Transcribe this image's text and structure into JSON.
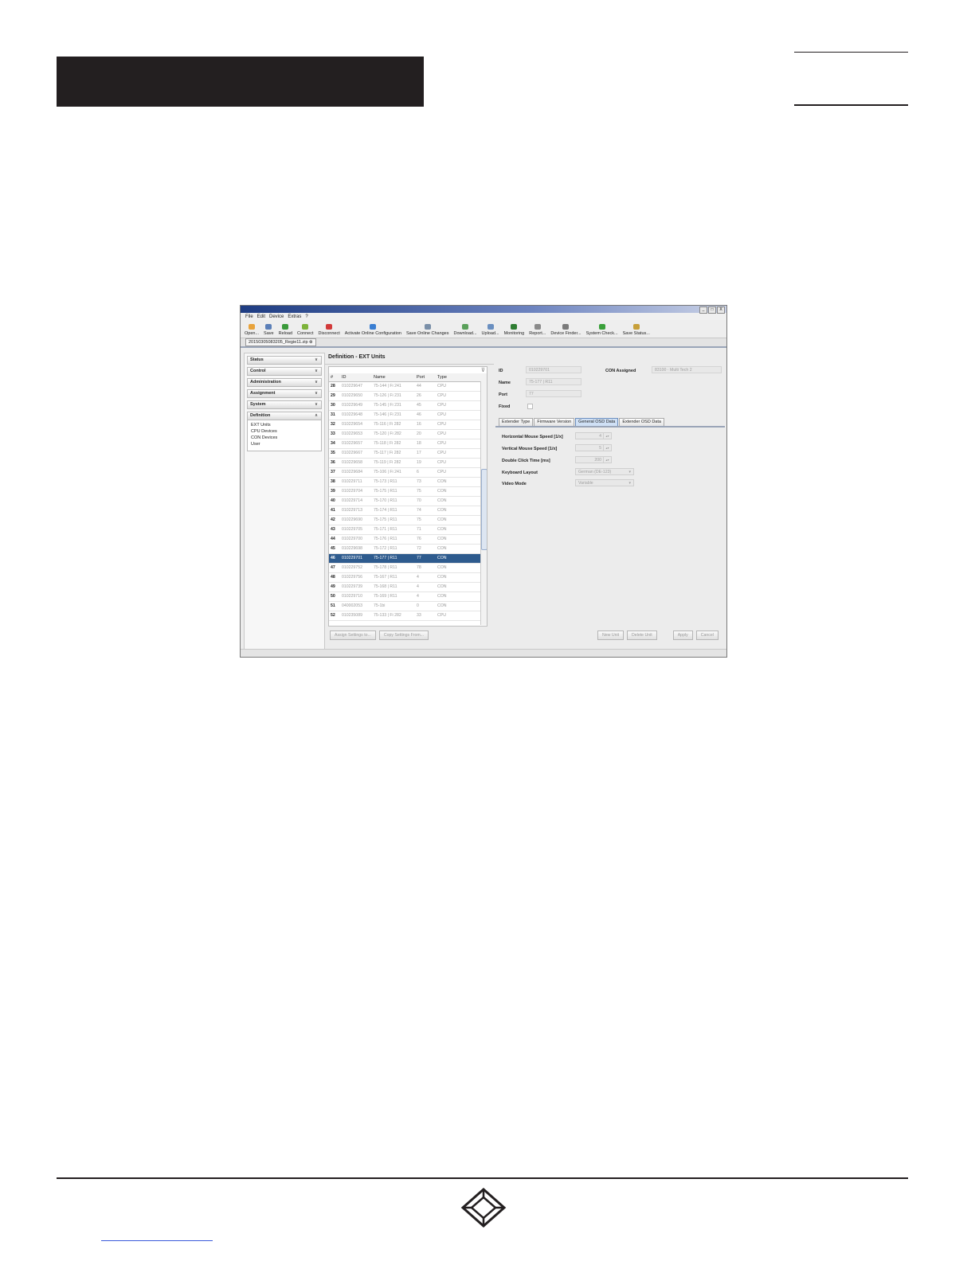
{
  "app": {
    "menu": [
      "File",
      "Edit",
      "Device",
      "Extras",
      "?"
    ],
    "window_controls": [
      "_",
      "□",
      "X"
    ],
    "toolbar": [
      {
        "label": "Open...",
        "icon": "folder-icon",
        "color": "#e8a33c"
      },
      {
        "label": "Save",
        "icon": "disk-icon",
        "color": "#5b7fb8"
      },
      {
        "label": "Reload",
        "icon": "reload-icon",
        "color": "#3a9a3a"
      },
      {
        "label": "Connect",
        "icon": "plug-connect-icon",
        "color": "#7db33a"
      },
      {
        "label": "Disconnect",
        "icon": "plug-disconnect-icon",
        "color": "#d23a3a"
      },
      {
        "label": "Activate Online Configuration",
        "icon": "globe-icon",
        "color": "#3a7ed2"
      },
      {
        "label": "Save Online Changes",
        "icon": "save-online-icon",
        "color": "#7a8fa8"
      },
      {
        "label": "Download...",
        "icon": "download-icon",
        "color": "#5aa05a"
      },
      {
        "label": "Upload...",
        "icon": "upload-icon",
        "color": "#6a8fc0"
      },
      {
        "label": "Monitoring",
        "icon": "monitor-icon",
        "color": "#2e7d32"
      },
      {
        "label": "Report...",
        "icon": "report-icon",
        "color": "#8a8a8a"
      },
      {
        "label": "Device Finder...",
        "icon": "device-finder-icon",
        "color": "#7a7a7a"
      },
      {
        "label": "System Check...",
        "icon": "check-icon",
        "color": "#3aa03a"
      },
      {
        "label": "Save Status...",
        "icon": "save-status-icon",
        "color": "#c8a03a"
      }
    ],
    "doc_tab": "20150305083205_Regie11.zip"
  },
  "sidebar": {
    "sections": [
      {
        "label": "Status",
        "chevron": "∨"
      },
      {
        "label": "Control",
        "chevron": "∨"
      },
      {
        "label": "Administration",
        "chevron": "∨"
      },
      {
        "label": "Assignment",
        "chevron": "∨"
      },
      {
        "label": "System",
        "chevron": "∨"
      },
      {
        "label": "Definition",
        "chevron": "∧"
      }
    ],
    "definition_items": [
      "EXT Units",
      "CPU Devices",
      "CON Devices",
      "User"
    ]
  },
  "main": {
    "title": "Definition - EXT Units",
    "columns": [
      "#",
      "ID",
      "Name",
      "Port",
      "Type"
    ],
    "rows": [
      [
        "28",
        "010229647",
        "75-144 | Fi 241",
        "44",
        "CPU"
      ],
      [
        "29",
        "010229650",
        "75-126 | Fi 231",
        "26",
        "CPU"
      ],
      [
        "30",
        "010229649",
        "75-145 | Fi 231",
        "45",
        "CPU"
      ],
      [
        "31",
        "010229648",
        "75-146 | Fi 231",
        "46",
        "CPU"
      ],
      [
        "32",
        "010229654",
        "75-116 | Fi 282",
        "16",
        "CPU"
      ],
      [
        "33",
        "010229653",
        "75-120 | Fi 282",
        "20",
        "CPU"
      ],
      [
        "34",
        "010229657",
        "75-118 | Fi 282",
        "18",
        "CPU"
      ],
      [
        "35",
        "010229667",
        "75-117 | Fi 282",
        "17",
        "CPU"
      ],
      [
        "36",
        "010229658",
        "75-119 | Fi 282",
        "19",
        "CPU"
      ],
      [
        "37",
        "010229684",
        "75-106 | Fi 241",
        "6",
        "CPU"
      ],
      [
        "38",
        "010229711",
        "75-173 | R11",
        "73",
        "CON"
      ],
      [
        "39",
        "010229704",
        "75-175 | R11",
        "75",
        "CON"
      ],
      [
        "40",
        "010229714",
        "75-170 | R11",
        "70",
        "CON"
      ],
      [
        "41",
        "010229713",
        "75-174 | R11",
        "74",
        "CON"
      ],
      [
        "42",
        "010229690",
        "75-175 | R11",
        "75",
        "CON"
      ],
      [
        "43",
        "010229705",
        "75-171 | R11",
        "71",
        "CON"
      ],
      [
        "44",
        "010229700",
        "75-176 | R11",
        "76",
        "CON"
      ],
      [
        "45",
        "010229698",
        "75-172 | R11",
        "72",
        "CON"
      ],
      [
        "46",
        "010229701",
        "75-177 | R11",
        "77",
        "CON"
      ],
      [
        "47",
        "010229752",
        "75-178 | R11",
        "78",
        "CON"
      ],
      [
        "48",
        "010229756",
        "75-167 | R11",
        "4",
        "CON"
      ],
      [
        "49",
        "010229739",
        "75-168 | R11",
        "4",
        "CON"
      ],
      [
        "50",
        "010229710",
        "75-169 | R11",
        "4",
        "CON"
      ],
      [
        "51",
        "040002053",
        "75-1bi",
        "0",
        "CON"
      ],
      [
        "52",
        "010235089",
        "75-133 | Fi 282",
        "33",
        "CPU"
      ]
    ],
    "selected_row": "46",
    "buttons": [
      "Assign Settings to...",
      "Copy Settings From..."
    ]
  },
  "detail": {
    "id_label": "ID",
    "id_value": "010229701",
    "name_label": "Name",
    "name_value": "75-177 | R11",
    "port_label": "Port",
    "port_value": "77",
    "fixed_label": "Fixed",
    "con_label": "CON Assigned",
    "con_value": "83100 · Multi Tech 2",
    "tabs": [
      "Extender Type",
      "Firmware Version",
      "General OSD Data",
      "Extender OSD Data"
    ],
    "active_tab": "General OSD Data",
    "osd": {
      "h_mouse_label": "Horizontal Mouse Speed [1/x]",
      "h_mouse_value": "4",
      "v_mouse_label": "Vertical Mouse Speed [1/x]",
      "v_mouse_value": "5",
      "dbl_click_label": "Double Click Time [ms]",
      "dbl_click_value": "200",
      "keyboard_label": "Keyboard Layout",
      "keyboard_value": "German (DE-123)",
      "video_label": "Video Mode",
      "video_value": "Variable"
    },
    "buttons": [
      "New Unit",
      "Delete Unit",
      "Apply",
      "Cancel"
    ]
  },
  "colors": {
    "selection": "#2e5b8e",
    "page_bar": "#231f20"
  }
}
